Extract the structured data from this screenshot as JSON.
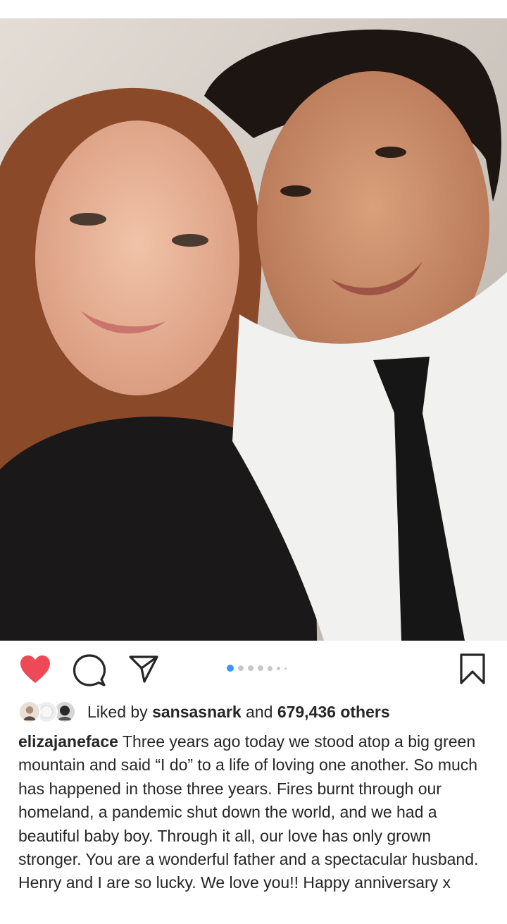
{
  "post": {
    "image_alt": "Couple selfie",
    "carousel": {
      "count": 7,
      "active_index": 0
    },
    "liked": true
  },
  "icons": {
    "like": "heart-filled-icon",
    "comment": "speech-bubble-icon",
    "share": "paper-plane-icon",
    "save": "bookmark-icon"
  },
  "likes": {
    "prefix": "Liked by",
    "user": "sansasnark",
    "middle": "and",
    "others": "679,436 others"
  },
  "caption": {
    "username": "elizajaneface",
    "text": "Three years ago today we stood atop a big green mountain and said “I do” to a life of loving one another. So much has happened in those three years. Fires burnt through our homeland, a pandemic shut down the world, and we had a beautiful baby boy. Through it all, our love has only grown stronger. You are a wonderful father and a spectacular husband. Henry and I are so lucky. We love you!! Happy anniversary x"
  },
  "colors": {
    "heart": "#ed4956",
    "active_dot": "#3897f0",
    "inactive_dot": "#c7c7c7",
    "text": "#262626"
  }
}
